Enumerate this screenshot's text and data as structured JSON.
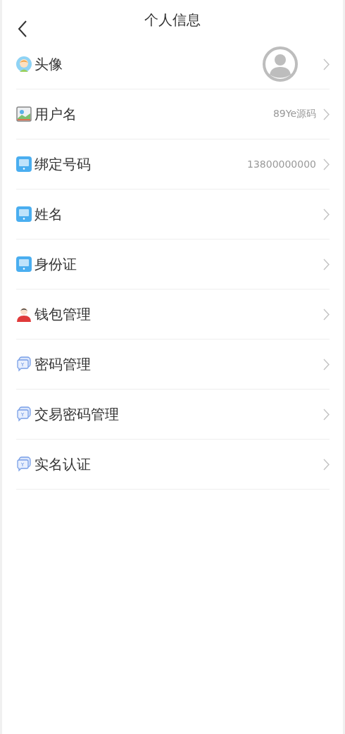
{
  "header": {
    "title": "个人信息"
  },
  "items": [
    {
      "kind": "avatar",
      "label": "头像",
      "photo": true
    },
    {
      "kind": "image",
      "label": "用户名",
      "value": "89Ye源码"
    },
    {
      "kind": "monitor",
      "label": "绑定号码",
      "value": "13800000000"
    },
    {
      "kind": "monitor",
      "label": "姓名"
    },
    {
      "kind": "monitor",
      "label": "身份证"
    },
    {
      "kind": "person",
      "label": "钱包管理"
    },
    {
      "kind": "chat",
      "label": "密码管理"
    },
    {
      "kind": "chat",
      "label": "交易密码管理"
    },
    {
      "kind": "chat",
      "label": "实名认证"
    }
  ]
}
